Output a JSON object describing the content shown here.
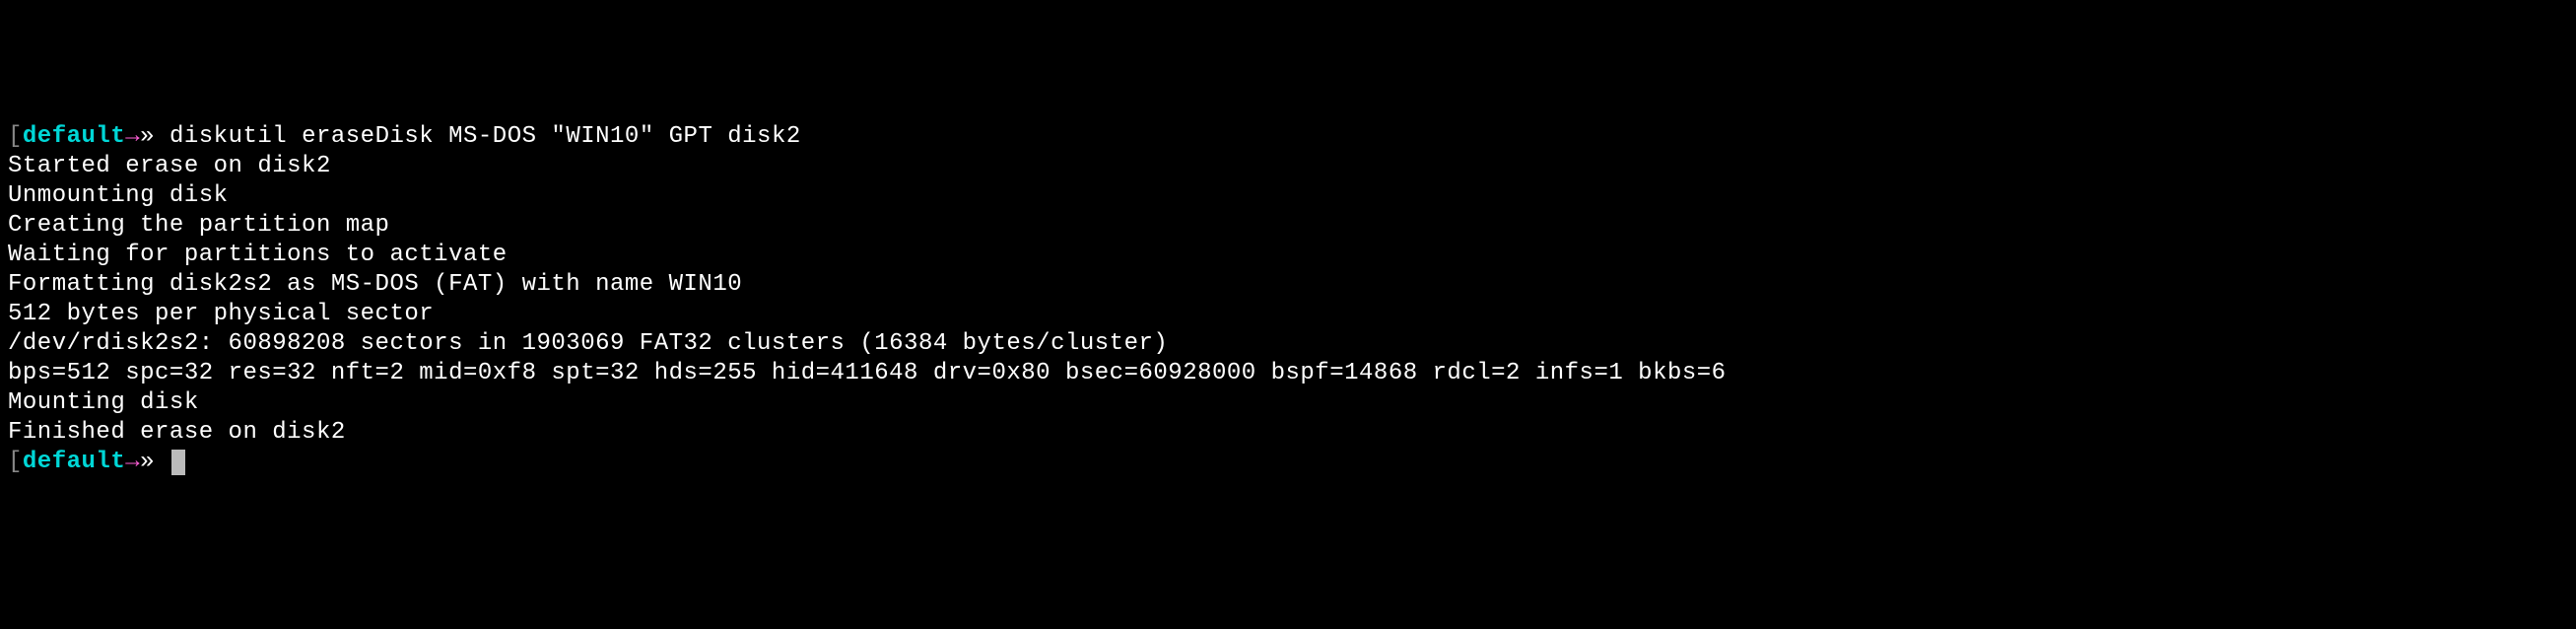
{
  "prompt": {
    "bracket_open": "[",
    "user": "default",
    "arrow": "→",
    "chevron": "»",
    "bracket_close": "["
  },
  "command": "diskutil eraseDisk MS-DOS \"WIN10\" GPT disk2",
  "output": {
    "line1": "Started erase on disk2",
    "line2": "Unmounting disk",
    "line3": "Creating the partition map",
    "line4": "Waiting for partitions to activate",
    "line5": "Formatting disk2s2 as MS-DOS (FAT) with name WIN10",
    "line6": "512 bytes per physical sector",
    "line7": "/dev/rdisk2s2: 60898208 sectors in 1903069 FAT32 clusters (16384 bytes/cluster)",
    "line8": "bps=512 spc=32 res=32 nft=2 mid=0xf8 spt=32 hds=255 hid=411648 drv=0x80 bsec=60928000 bspf=14868 rdcl=2 infs=1 bkbs=6",
    "line9": "Mounting disk",
    "line10": "Finished erase on disk2"
  }
}
